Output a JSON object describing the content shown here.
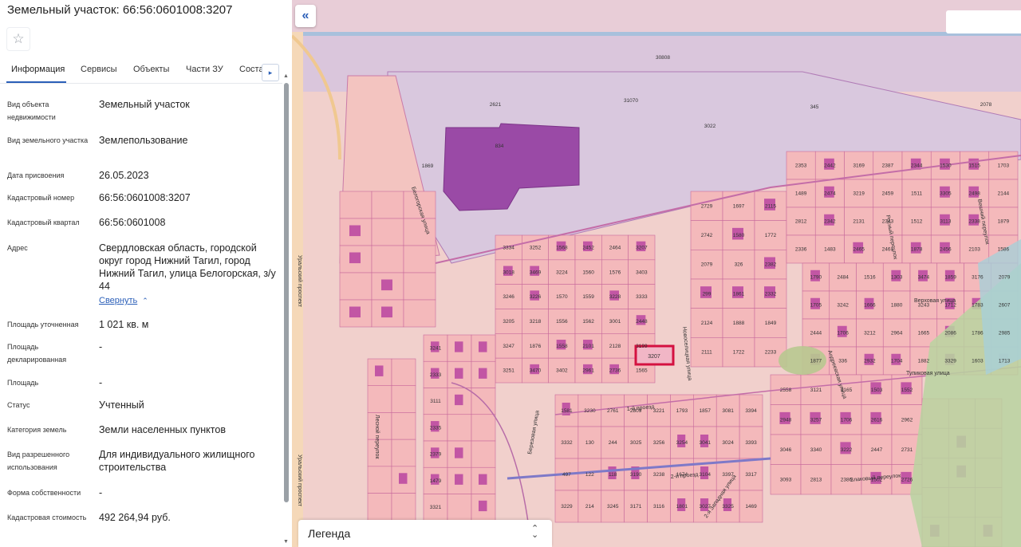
{
  "panel": {
    "title": "Земельный участок: 66:56:0601008:3207",
    "star_icon": "☆",
    "tabs": [
      "Информация",
      "Сервисы",
      "Объекты",
      "Части ЗУ",
      "Соста"
    ],
    "tab_next_icon": "▸",
    "rows": [
      {
        "label": "Вид объекта недвижимости",
        "value": "Земельный участок"
      },
      {
        "label": "Вид земельного участка",
        "value": "Землепользование"
      },
      {
        "label": "Дата присвоения",
        "value": "26.05.2023"
      },
      {
        "label": "Кадастровый номер",
        "value": "66:56:0601008:3207"
      },
      {
        "label": "Кадастровый квартал",
        "value": "66:56:0601008"
      },
      {
        "label": "Адрес",
        "value": "Свердловская область, городской округ город Нижний Тагил, город Нижний Тагил, улица Белогорская, з/у 44"
      },
      {
        "label": "Площадь уточненная",
        "value": "1 021 кв. м"
      },
      {
        "label": "Площадь декларированная",
        "value": "-"
      },
      {
        "label": "Площадь",
        "value": "-"
      },
      {
        "label": "Статус",
        "value": "Учтенный"
      },
      {
        "label": "Категория земель",
        "value": "Земли населенных пунктов"
      },
      {
        "label": "Вид разрешенного использования",
        "value": "Для индивидуального жилищного строительства"
      },
      {
        "label": "Форма собственности",
        "value": "-"
      },
      {
        "label": "Кадастровая стоимость",
        "value": "492 264,94 руб."
      }
    ],
    "collapse_link": "Свернуть",
    "collapse_chevron": "⌃"
  },
  "map": {
    "collapse_icon": "«",
    "legend_label": "Легенда",
    "legend_icon": "⌃⌄",
    "streets": [
      "Белогорская улица",
      "Уральский проспект",
      "Уральский проспект",
      "Верховая улица",
      "Тупиковая улица",
      "Андреевская улица",
      "Новоселицкая улица",
      "1-й проезд",
      "2-й проезд",
      "2-я Западная улица",
      "Злаковый переулок",
      "Росный переулок",
      "Вешний переулок",
      "Лесной переулок",
      "Березовая улица"
    ],
    "highlight_label": "3207",
    "parcel_numbers": [
      "30808",
      "2621",
      "3022",
      "31070",
      "2078",
      "345",
      "834",
      "1869",
      "3334",
      "3018",
      "3246",
      "3205",
      "3247",
      "3251",
      "3252",
      "3469",
      "3226",
      "3218",
      "1876",
      "3470",
      "1568",
      "3224",
      "1570",
      "1556",
      "1558",
      "3402",
      "2452",
      "1560",
      "1559",
      "1562",
      "2101",
      "2961",
      "2464",
      "1576",
      "3228",
      "3001",
      "2128",
      "2736",
      "3207",
      "3403",
      "3333",
      "2448",
      "3199",
      "1565",
      "2729",
      "2742",
      "2079",
      "299",
      "2124",
      "2111",
      "1697",
      "1580",
      "326",
      "1861",
      "1888",
      "1722",
      "2115",
      "1772",
      "2382",
      "2332",
      "1849",
      "2233",
      "2353",
      "1489",
      "2812",
      "2336",
      "2442",
      "2474",
      "2342",
      "1483",
      "3169",
      "3219",
      "2131",
      "2465",
      "2387",
      "2459",
      "2343",
      "2461",
      "2344",
      "1511",
      "1512",
      "1878",
      "1530",
      "3305",
      "3113",
      "2456",
      "1515",
      "2498",
      "2338",
      "2103",
      "1703",
      "2144",
      "1879",
      "1586",
      "1790",
      "1705",
      "2444",
      "1877",
      "2484",
      "3242",
      "1706",
      "336",
      "1516",
      "1666",
      "3212",
      "2932",
      "1303",
      "1880",
      "2964",
      "1704",
      "3474",
      "3243",
      "1665",
      "1882",
      "1859",
      "1712",
      "2086",
      "3329",
      "3176",
      "1783",
      "1786",
      "1603",
      "2079",
      "2607",
      "2985",
      "1713",
      "1581",
      "3332",
      "497",
      "3229",
      "3230",
      "130",
      "122",
      "214",
      "2761",
      "244",
      "118",
      "3245",
      "2809",
      "3025",
      "3190",
      "3171",
      "3221",
      "3256",
      "3238",
      "3116",
      "1793",
      "3254",
      "1674",
      "1801",
      "1857",
      "3041",
      "3104",
      "3027",
      "3081",
      "3024",
      "3397",
      "3325",
      "3394",
      "3393",
      "3317",
      "1469",
      "2558",
      "2948",
      "3046",
      "3093",
      "3121",
      "3257",
      "3340",
      "2813",
      "3165",
      "1706",
      "3222",
      "2386",
      "1503",
      "2616",
      "2447",
      "1502",
      "1552",
      "2962",
      "2731",
      "2726",
      "3241",
      "2333",
      "3111",
      "2335",
      "2379",
      "1479",
      "3321",
      "1568"
    ]
  }
}
